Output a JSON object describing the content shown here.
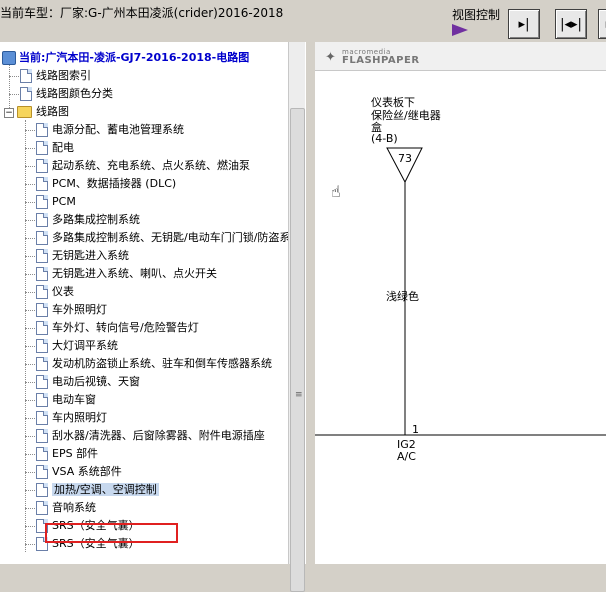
{
  "header": {
    "title": "当前车型：厂家:G-广州本田凌派(crider)2016-2018",
    "view_control_label": "视图控制",
    "buttons": [
      {
        "icon": "next-page-icon",
        "glyph": "▸|"
      },
      {
        "icon": "fit-width-icon",
        "glyph": "|◂▸|"
      },
      {
        "icon": "more-icon",
        "glyph": "▸"
      }
    ]
  },
  "tree": {
    "current_label": "当前:广汽本田-凌派-GJ7-2016-2018-电路图",
    "top_items": [
      "线路图索引",
      "线路图颜色分类"
    ],
    "folder_label": "线路图",
    "folder_expander": "−",
    "items": [
      "电源分配、蓄电池管理系统",
      "配电",
      "起动系统、充电系统、点火系统、燃油泵",
      "PCM、数据插接器 (DLC)",
      "PCM",
      "多路集成控制系统",
      "多路集成控制系统、无钥匙/电动车门门锁/防盗系",
      "无钥匙进入系统",
      "无钥匙进入系统、喇叭、点火开关",
      "仪表",
      "车外照明灯",
      "车外灯、转向信号/危险警告灯",
      "大灯调平系统",
      "发动机防盗锁止系统、驻车和倒车传感器系统",
      "电动后视镜、天窗",
      "电动车窗",
      "车内照明灯",
      "刮水器/清洗器、后窗除雾器、附件电源插座",
      "EPS 部件",
      "VSA 系统部件",
      "加热/空调、空调控制",
      "音响系统",
      "SRS（安全气囊）",
      "SRS（安全气囊）"
    ],
    "selected_index": 20
  },
  "viewer": {
    "brand_top": "macromedia",
    "brand_bottom": "FLASHPAPER",
    "diagram": {
      "component_line1": "仪表板下",
      "component_line2": "保险丝/继电器",
      "component_line3": "盒",
      "component_ref": "(4-B)",
      "fuse_number": "73",
      "wire_color": "浅绿色",
      "pin_number": "1",
      "connector_line1": "IG2",
      "connector_line2": "A/C"
    }
  }
}
